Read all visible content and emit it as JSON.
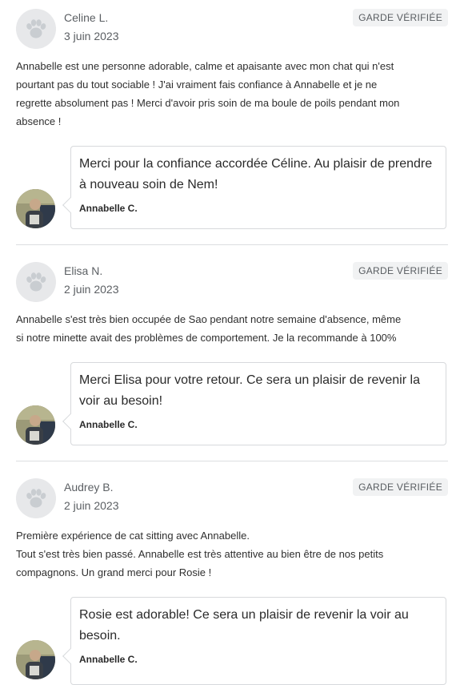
{
  "reviews": [
    {
      "name": "Celine L.",
      "date": "3 juin 2023",
      "badge": "GARDE VÉRIFIÉE",
      "text": "Annabelle est une personne adorable, calme et apaisante avec mon chat qui n'est\npourtant pas du tout sociable ! J'ai vraiment fais confiance à Annabelle et je ne\nregrette absolument pas ! Merci d'avoir pris soin de ma boule de poils pendant mon\nabsence !",
      "reply_text": "Merci pour la confiance accordée Céline. Au plaisir de prendre à nouveau soin de Nem!",
      "reply_author": "Annabelle C."
    },
    {
      "name": "Elisa N.",
      "date": "2 juin 2023",
      "badge": "GARDE VÉRIFIÉE",
      "text": "Annabelle s'est très bien occupée de Sao pendant notre semaine d'absence, même\nsi notre minette avait des problèmes de comportement. Je la recommande à 100%",
      "reply_text": "Merci Elisa pour votre retour. Ce sera un plaisir de revenir la voir au besoin!",
      "reply_author": "Annabelle C."
    },
    {
      "name": "Audrey B.",
      "date": "2 juin 2023",
      "badge": "GARDE VÉRIFIÉE",
      "text": "Première expérience de cat sitting avec Annabelle.\nTout s'est très bien passé. Annabelle est très attentive au bien être de nos petits\ncompagnons. Un grand merci pour Rosie !",
      "reply_text": "Rosie est adorable! Ce sera un plaisir de revenir la voir au besoin.",
      "reply_author": "Annabelle C."
    }
  ],
  "icons": {
    "reviewer_avatar": "paw-icon",
    "sitter_avatar": "sitter-photo"
  },
  "colors": {
    "badge_bg": "#f1f2f3",
    "divider": "#dcdee0",
    "paw": "#c9cdd1"
  }
}
